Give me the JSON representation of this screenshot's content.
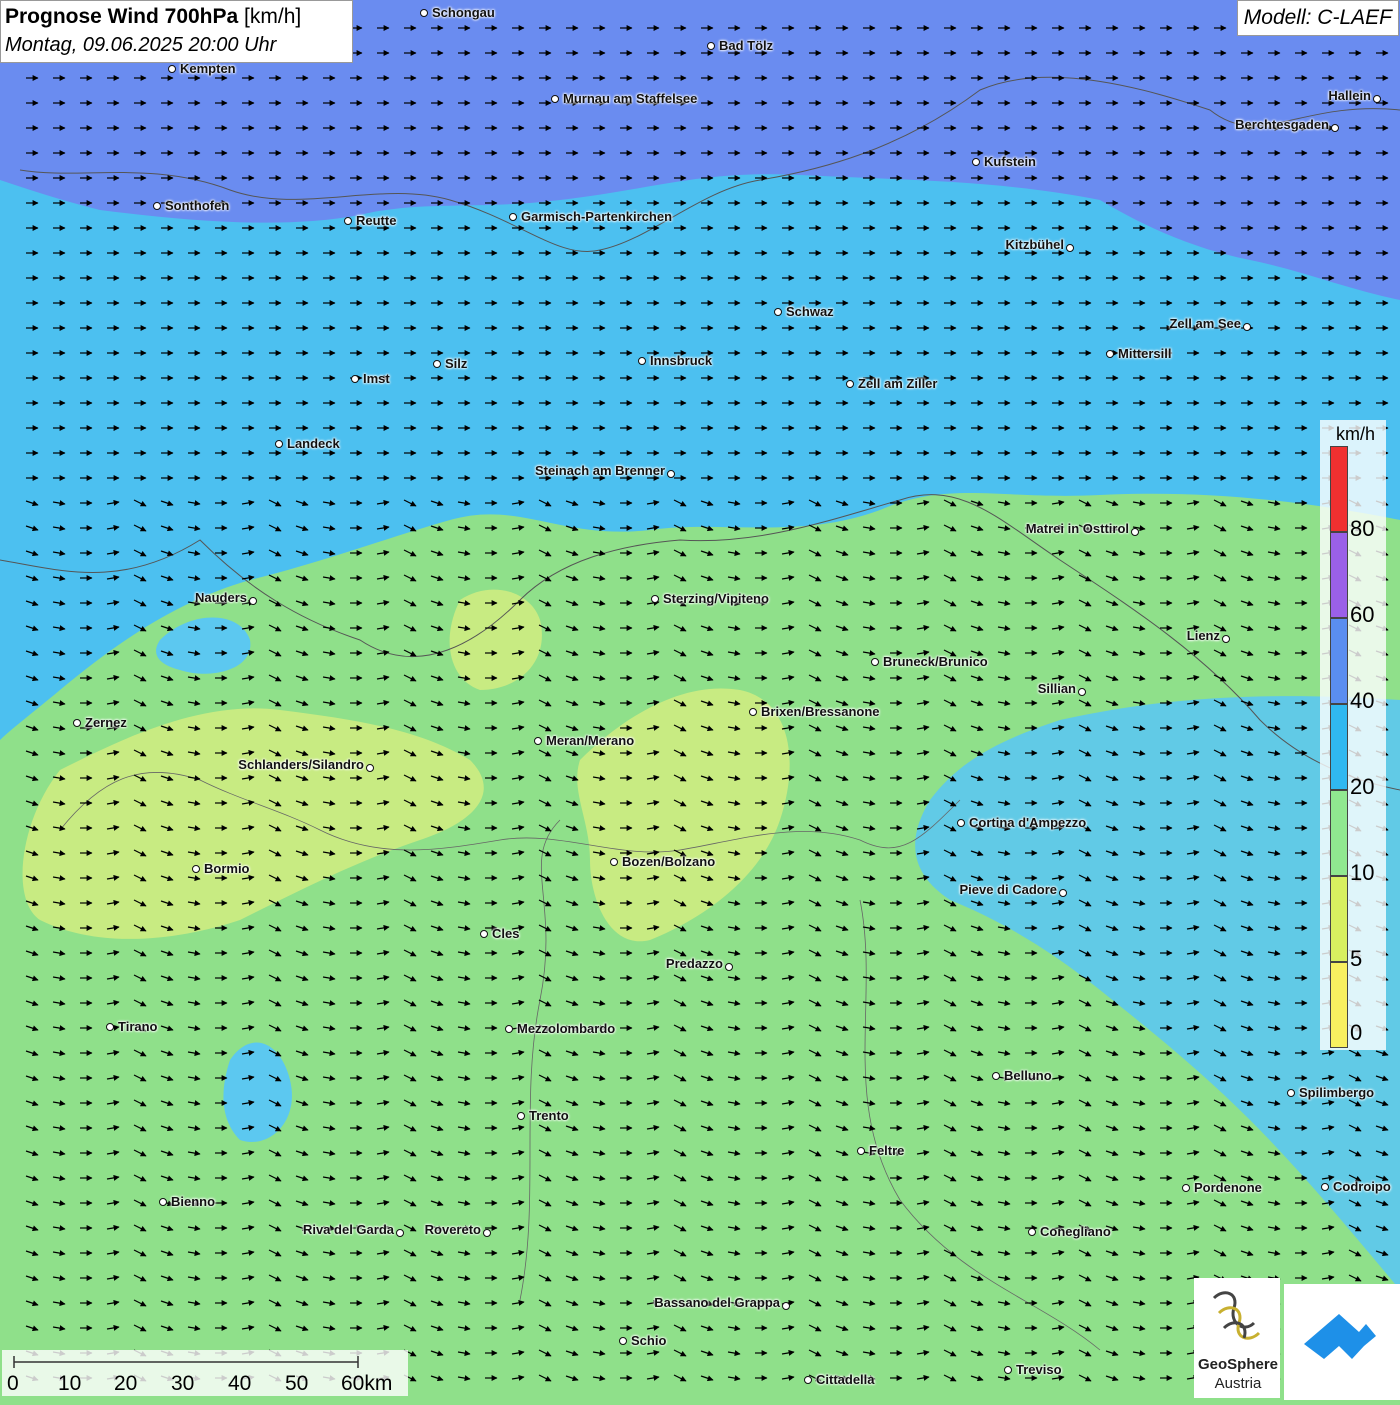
{
  "title": {
    "main": "Prognose Wind 700hPa",
    "unit": "[km/h]",
    "datetime": "Montag, 09.06.2025 20:00 Uhr"
  },
  "model": "Modell: C-LAEF",
  "legend": {
    "unit": "km/h",
    "labels": [
      "80",
      "60",
      "40",
      "20",
      "10",
      "5",
      "0"
    ],
    "colors": [
      "#f03030",
      "#9a60e8",
      "#5a8ef0",
      "#30b8f0",
      "#90e890",
      "#d8f060",
      "#f8f060"
    ]
  },
  "scale": {
    "labels": [
      "0",
      "10",
      "20",
      "30",
      "40",
      "50",
      "60km"
    ]
  },
  "logo": {
    "name1": "GeoSphere",
    "name2": "Austria"
  },
  "cities": [
    {
      "name": "Schongau"
    },
    {
      "name": "Bad Tölz"
    },
    {
      "name": "Kempten"
    },
    {
      "name": "Murnau am Staffelsee"
    },
    {
      "name": "Hallein"
    },
    {
      "name": "Berchtesgaden"
    },
    {
      "name": "Kufstein"
    },
    {
      "name": "Sonthofen"
    },
    {
      "name": "Reutte"
    },
    {
      "name": "Garmisch-Partenkirchen"
    },
    {
      "name": "Kitzbühel"
    },
    {
      "name": "Schwaz"
    },
    {
      "name": "Zell am See"
    },
    {
      "name": "Mittersill"
    },
    {
      "name": "Innsbruck"
    },
    {
      "name": "Imst"
    },
    {
      "name": "Silz"
    },
    {
      "name": "Zell am Ziller"
    },
    {
      "name": "Landeck"
    },
    {
      "name": "Steinach am Brenner"
    },
    {
      "name": "Matrei in Osttirol"
    },
    {
      "name": "Nauders"
    },
    {
      "name": "Sterzing/Vipiteno"
    },
    {
      "name": "Lienz"
    },
    {
      "name": "Bruneck/Brunico"
    },
    {
      "name": "Sillian"
    },
    {
      "name": "Brixen/Bressanone"
    },
    {
      "name": "Zernez"
    },
    {
      "name": "Meran/Merano"
    },
    {
      "name": "Schlanders/Silandro"
    },
    {
      "name": "Cortina d'Ampezzo"
    },
    {
      "name": "Bozen/Bolzano"
    },
    {
      "name": "Bormio"
    },
    {
      "name": "Pieve di Cadore"
    },
    {
      "name": "Cles"
    },
    {
      "name": "Predazzo"
    },
    {
      "name": "Tirano"
    },
    {
      "name": "Mezzolombardo"
    },
    {
      "name": "Belluno"
    },
    {
      "name": "Spilimbergo"
    },
    {
      "name": "Trento"
    },
    {
      "name": "Feltre"
    },
    {
      "name": "Pordenone"
    },
    {
      "name": "Codroipo"
    },
    {
      "name": "Bienno"
    },
    {
      "name": "Riva del Garda"
    },
    {
      "name": "Rovereto"
    },
    {
      "name": "Conegliano"
    },
    {
      "name": "Bassano del Grappa"
    },
    {
      "name": "Schio"
    },
    {
      "name": "Treviso"
    },
    {
      "name": "Cittadella"
    }
  ]
}
